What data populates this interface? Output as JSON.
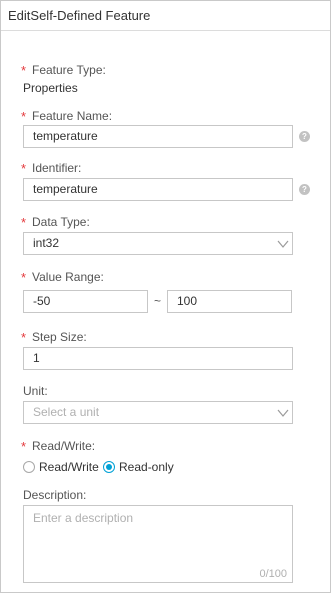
{
  "panel": {
    "title": "EditSelf-Defined Feature"
  },
  "required_mark": "*",
  "help_glyph": "?",
  "feature_type": {
    "label": "Feature Type:",
    "value": "Properties"
  },
  "feature_name": {
    "label": "Feature Name:",
    "value": "temperature"
  },
  "identifier": {
    "label": "Identifier:",
    "value": "temperature"
  },
  "data_type": {
    "label": "Data Type:",
    "value": "int32"
  },
  "value_range": {
    "label": "Value Range:",
    "min": "-50",
    "separator": "~",
    "max": "100"
  },
  "step_size": {
    "label": "Step Size:",
    "value": "1"
  },
  "unit": {
    "label": "Unit:",
    "placeholder": "Select a unit"
  },
  "read_write": {
    "label": "Read/Write:",
    "options": [
      {
        "label": "Read/Write",
        "checked": false
      },
      {
        "label": "Read-only",
        "checked": true
      }
    ]
  },
  "description": {
    "label": "Description:",
    "placeholder": "Enter a description",
    "counter": "0/100"
  },
  "colors": {
    "accent": "#00a1d6",
    "required": "#e4393c",
    "border": "#c7c7c7"
  }
}
